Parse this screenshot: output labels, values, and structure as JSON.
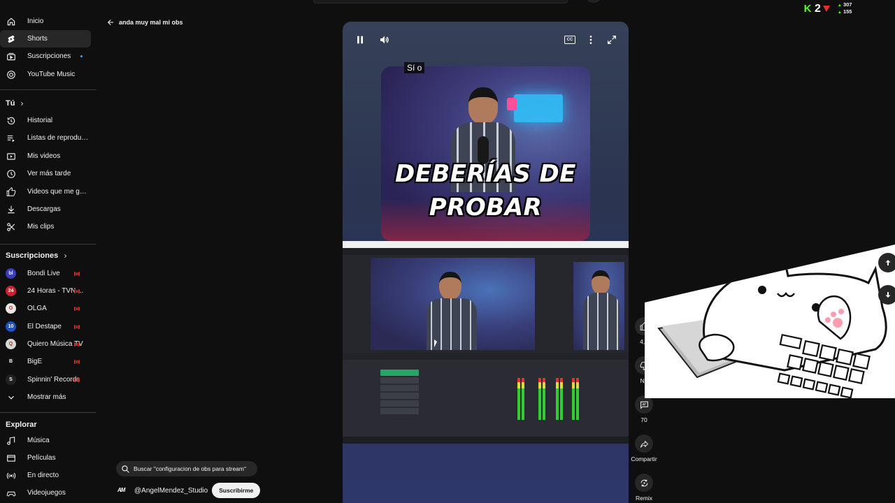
{
  "sidebar": {
    "main": [
      {
        "label": "Inicio",
        "icon": "home-icon"
      },
      {
        "label": "Shorts",
        "icon": "shorts-icon",
        "active": true
      },
      {
        "label": "Suscripciones",
        "icon": "subscriptions-icon"
      },
      {
        "label": "YouTube Music",
        "icon": "youtube-music-icon"
      }
    ],
    "you_title": "Tú",
    "you": [
      {
        "label": "Historial",
        "icon": "history-icon"
      },
      {
        "label": "Listas de reproducc...",
        "icon": "playlists-icon"
      },
      {
        "label": "Mis videos",
        "icon": "my-videos-icon"
      },
      {
        "label": "Ver más tarde",
        "icon": "watch-later-icon"
      },
      {
        "label": "Videos que me gus...",
        "icon": "liked-videos-icon"
      },
      {
        "label": "Descargas",
        "icon": "downloads-icon"
      },
      {
        "label": "Mis clips",
        "icon": "clips-icon"
      }
    ],
    "subs_title": "Suscripciones",
    "subs": [
      {
        "label": "Bondi Live",
        "color": "#3a3fb8",
        "short": "bl"
      },
      {
        "label": "24 Horas - TVN ...",
        "color": "#d32030",
        "short": "24"
      },
      {
        "label": "OLGA",
        "color": "#e8e8e8",
        "short": "O"
      },
      {
        "label": "El Destape",
        "color": "#1b52c4",
        "short": "10"
      },
      {
        "label": "Quiero Música TV",
        "color": "#d8d8d8",
        "short": "Q"
      },
      {
        "label": "BigE",
        "color": "#111111",
        "short": "B"
      },
      {
        "label": "Spinnin' Records",
        "color": "#222222",
        "short": "S"
      }
    ],
    "show_more": "Mostrar más",
    "explore_title": "Explorar",
    "explore": [
      {
        "label": "Música",
        "icon": "music-icon"
      },
      {
        "label": "Películas",
        "icon": "movies-icon"
      },
      {
        "label": "En directo",
        "icon": "live-icon"
      },
      {
        "label": "Videojuegos",
        "icon": "gaming-icon"
      }
    ]
  },
  "back_label": "anda muy mal mi obs",
  "player": {
    "caption": "Sí o",
    "cc_label": "CC",
    "thumb_line1": "DEBERÍAS DE",
    "thumb_line2": "PROBAR"
  },
  "actions": {
    "likes": "4,7",
    "dislike_label": "No",
    "comments": "70",
    "share_label": "Compartir",
    "remix_label": "Remix"
  },
  "search_chip": "Buscar \"configuracion de obs para stream\"",
  "channel": {
    "name": "@AngelMendez_Studio",
    "subscribe": "Suscribirme",
    "logo": "AM"
  },
  "kick_overlay": {
    "count": "2",
    "stat_top": "307",
    "stat_bottom": "155"
  },
  "colors": {
    "background": "#0f0f0f",
    "active_item": "#272727",
    "accent_live": "#c4302b",
    "kick_green": "#53fc18"
  }
}
